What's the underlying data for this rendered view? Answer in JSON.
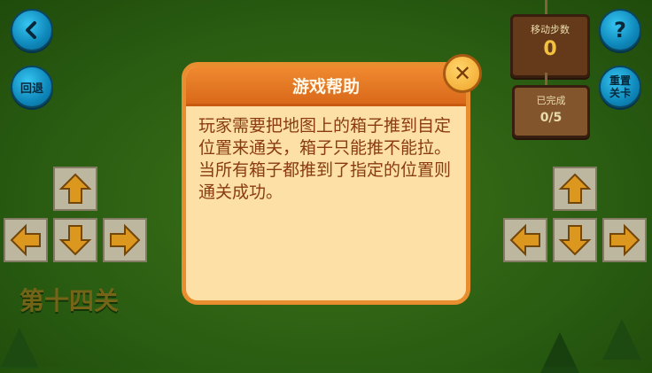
{
  "top_left": {
    "undo_label": "回退"
  },
  "top_right": {
    "help_label": "?",
    "reset_label_line1": "重置",
    "reset_label_line2": "关卡"
  },
  "steps": {
    "caption": "移动步数",
    "value": "0"
  },
  "completed": {
    "caption": "已完成",
    "value": "0/5"
  },
  "level": {
    "label": "第十四关"
  },
  "dialog": {
    "title": "游戏帮助",
    "body": "玩家需要把地图上的箱子推到自定位置来通关，箱子只能推不能拉。当所有箱子都推到了指定的位置则通关成功。"
  },
  "icons": {
    "back": "chevron-left-icon",
    "close": "close-icon",
    "up": "arrow-up-icon",
    "down": "arrow-down-icon",
    "left": "arrow-left-icon",
    "right": "arrow-right-icon"
  },
  "colors": {
    "dialog_border": "#e98e2f",
    "dialog_bg": "#fde0a6",
    "text": "#8a3b10",
    "button_blue": "#0f8fc4"
  }
}
